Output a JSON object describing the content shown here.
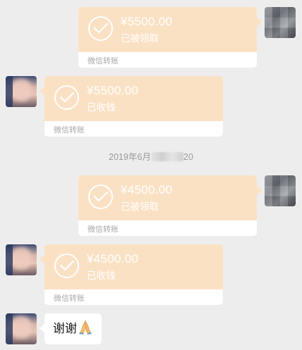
{
  "messages": [
    {
      "side": "right",
      "amount": "¥5500.00",
      "status": "已被领取",
      "label": "微信转账"
    },
    {
      "side": "left",
      "amount": "¥5500.00",
      "status": "已收钱",
      "label": "微信转账"
    },
    {
      "side": "right",
      "amount": "¥4500.00",
      "status": "已被领取",
      "label": "微信转账"
    },
    {
      "side": "left",
      "amount": "¥4500.00",
      "status": "已收钱",
      "label": "微信转账"
    }
  ],
  "timestamp": {
    "prefix": "2019年6月",
    "suffix": "20"
  },
  "text_message": {
    "text": "谢谢",
    "emoji": "folded-hands"
  },
  "colors": {
    "background": "#ededed",
    "transfer_card": "#fbe1c4",
    "card_footer": "#ffffff",
    "footer_text": "#a9a9a9"
  }
}
